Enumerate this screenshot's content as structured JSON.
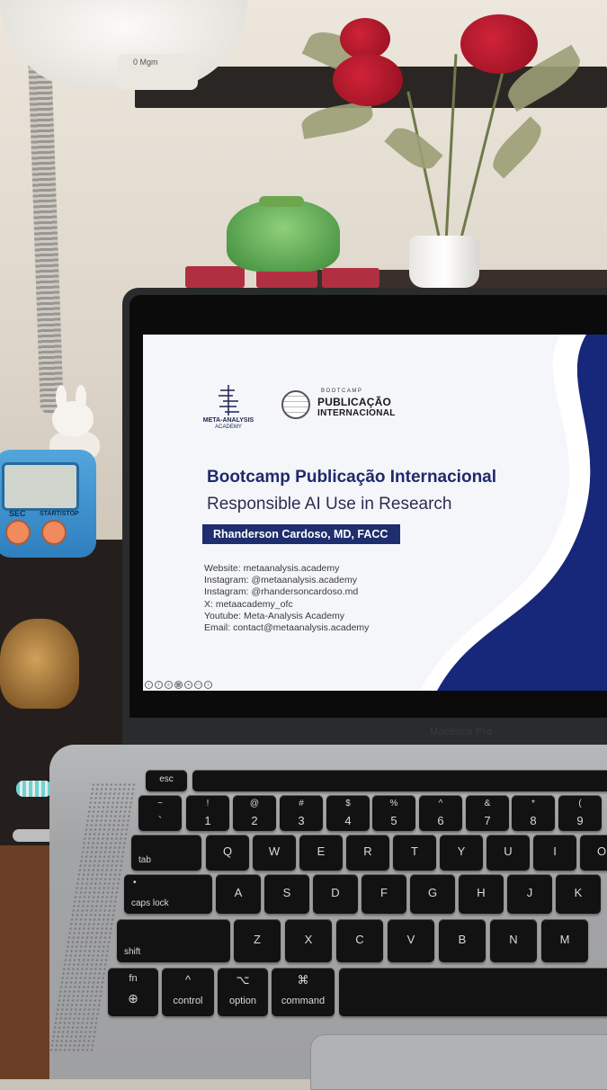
{
  "lamp": {
    "label": "0 Mgm"
  },
  "timer": {
    "sec_label": "SEC",
    "startstop_label": "START/STOP"
  },
  "laptop": {
    "model_label": "MacBook Pro"
  },
  "slide": {
    "logo_left_name": "META-ANALYSIS",
    "logo_left_sub": "ACADEMY",
    "logo_right_small": "BOOTCAMP",
    "logo_right_line1": "PUBLICAÇÃO",
    "logo_right_line2": "INTERNACIONAL",
    "title": "Bootcamp Publicação Internacional",
    "subtitle": "Responsible AI Use in Research",
    "author": "Rhanderson Cardoso, MD, FACC",
    "contacts": [
      "Website: metaanalysis.academy",
      "Instagram: @metaanalysis.academy",
      "Instagram: @rhandersoncardoso.md",
      "X: metaacademy_ofc",
      "Youtube: Meta-Analysis Academy",
      "Email: contact@metaanalysis.academy"
    ],
    "accent_color": "#1f2e6e",
    "wave_color": "#17287a"
  },
  "keyboard": {
    "esc": "esc",
    "num_row": [
      {
        "top": "~",
        "bot": "`"
      },
      {
        "top": "!",
        "bot": "1"
      },
      {
        "top": "@",
        "bot": "2"
      },
      {
        "top": "#",
        "bot": "3"
      },
      {
        "top": "$",
        "bot": "4"
      },
      {
        "top": "%",
        "bot": "5"
      },
      {
        "top": "^",
        "bot": "6"
      },
      {
        "top": "&",
        "bot": "7"
      },
      {
        "top": "*",
        "bot": "8"
      },
      {
        "top": "(",
        "bot": "9"
      }
    ],
    "tab": "tab",
    "q_row": [
      "Q",
      "W",
      "E",
      "R",
      "T",
      "Y",
      "U",
      "I",
      "O"
    ],
    "caps": "caps lock",
    "a_row": [
      "A",
      "S",
      "D",
      "F",
      "G",
      "H",
      "J",
      "K"
    ],
    "shift": "shift",
    "z_row": [
      "Z",
      "X",
      "C",
      "V",
      "B",
      "N",
      "M"
    ],
    "fn": "fn",
    "control_sym": "^",
    "control": "control",
    "option_sym": "⌥",
    "option": "option",
    "command_sym": "⌘",
    "command": "command"
  }
}
